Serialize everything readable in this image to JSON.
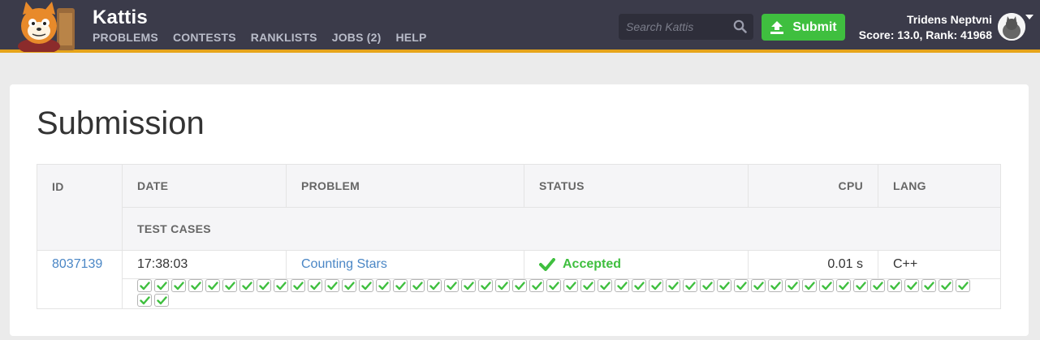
{
  "header": {
    "brand": "Kattis",
    "nav": [
      "PROBLEMS",
      "CONTESTS",
      "RANKLISTS",
      "JOBS (2)",
      "HELP"
    ],
    "search_placeholder": "Search Kattis",
    "submit_label": "Submit",
    "user": {
      "name": "Tridens Neptvni",
      "score_text": "Score: 13.0, Rank: 41968"
    },
    "icons": [
      "kattis-cat-logo",
      "search-icon",
      "upload-icon",
      "avatar",
      "dropdown-caret-icon"
    ],
    "colors": {
      "bar": "#3b3b4a",
      "accent": "#e6a41a",
      "submit": "#3fbf3f"
    }
  },
  "main": {
    "title": "Submission",
    "table": {
      "headers": {
        "id": "ID",
        "date": "DATE",
        "problem": "PROBLEM",
        "status": "STATUS",
        "cpu": "CPU",
        "lang": "LANG",
        "test_cases": "TEST CASES"
      },
      "row": {
        "id": "8037139",
        "date": "17:38:03",
        "problem": "Counting Stars",
        "status": "Accepted",
        "cpu": "0.01 s",
        "lang": "C++"
      },
      "test_cases_passed": 51,
      "status_color": "#3fbf3f"
    }
  }
}
